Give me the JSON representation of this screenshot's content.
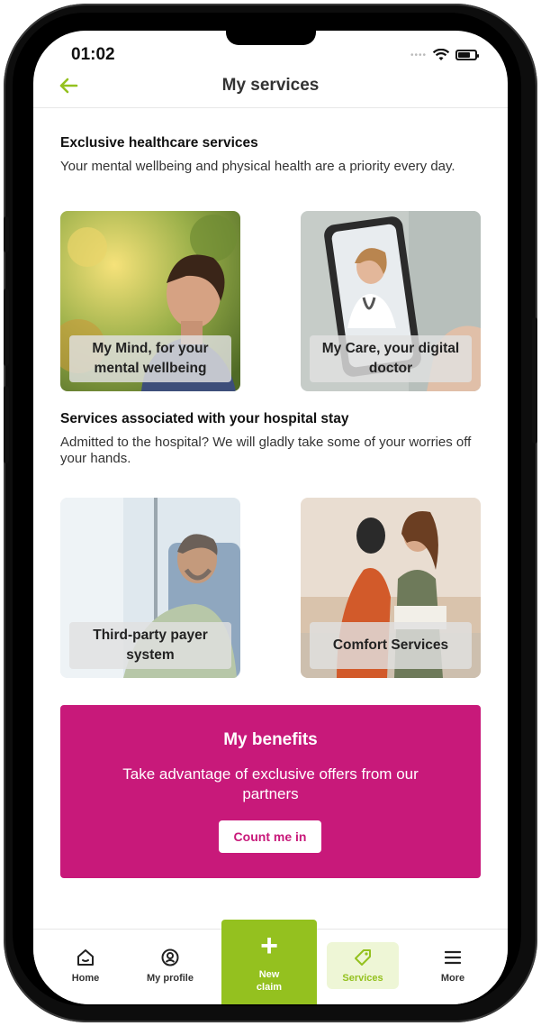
{
  "status_bar": {
    "time": "01:02"
  },
  "header": {
    "title": "My services"
  },
  "section1": {
    "heading": "Exclusive healthcare services",
    "description": "Your mental wellbeing and physical health are a priority every day."
  },
  "cards1": [
    {
      "label": "My Mind, for your mental wellbeing"
    },
    {
      "label": "My Care, your digital doctor"
    }
  ],
  "section2": {
    "heading": "Services associated with your hospital stay",
    "description": "Admitted to the hospital? We will gladly take some of your worries off your hands."
  },
  "cards2": [
    {
      "label": "Third-party payer system"
    },
    {
      "label": "Comfort Services"
    }
  ],
  "benefits": {
    "title": "My benefits",
    "text": "Take advantage of exclusive offers from our partners",
    "button": "Count me in"
  },
  "nav": {
    "home": "Home",
    "profile": "My profile",
    "new_claim": "New claim",
    "services": "Services",
    "more": "More"
  },
  "colors": {
    "brand_green": "#94c11f",
    "benefits_magenta": "#c8197a"
  }
}
